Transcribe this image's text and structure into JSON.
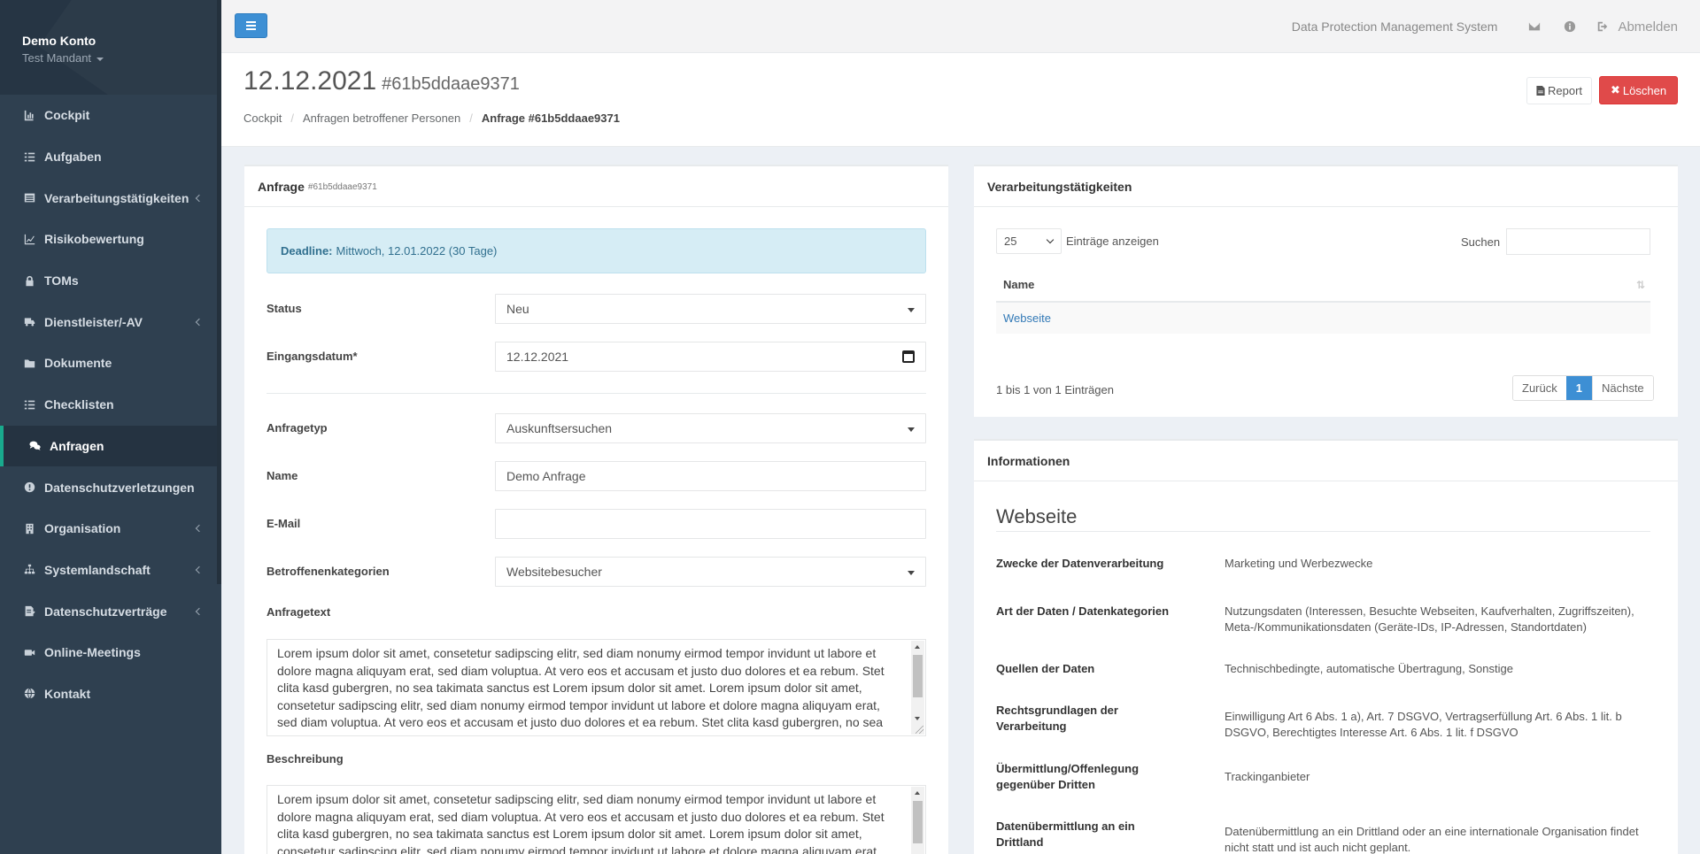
{
  "account": {
    "name": "Demo Konto",
    "tenant": "Test Mandant"
  },
  "nav": [
    {
      "label": "Cockpit",
      "icon": "chart-icon",
      "has_sub": false,
      "active": false
    },
    {
      "label": "Aufgaben",
      "icon": "tasks-icon",
      "has_sub": false,
      "active": false
    },
    {
      "label": "Verarbeitungstätigkeiten",
      "icon": "list-alt-icon",
      "has_sub": true,
      "active": false
    },
    {
      "label": "Risikobewertung",
      "icon": "line-chart-icon",
      "has_sub": false,
      "active": false
    },
    {
      "label": "TOMs",
      "icon": "lock-icon",
      "has_sub": false,
      "active": false
    },
    {
      "label": "Dienstleister/-AV",
      "icon": "truck-icon",
      "has_sub": true,
      "active": false
    },
    {
      "label": "Dokumente",
      "icon": "folder-icon",
      "has_sub": false,
      "active": false
    },
    {
      "label": "Checklisten",
      "icon": "checklist-icon",
      "has_sub": false,
      "active": false
    },
    {
      "label": "Anfragen",
      "icon": "comments-icon",
      "has_sub": false,
      "active": true
    },
    {
      "label": "Datenschutzverletzungen",
      "icon": "alert-circle-icon",
      "has_sub": false,
      "active": false
    },
    {
      "label": "Organisation",
      "icon": "building-icon",
      "has_sub": true,
      "active": false
    },
    {
      "label": "Systemlandschaft",
      "icon": "sitemap-icon",
      "has_sub": true,
      "active": false
    },
    {
      "label": "Datenschutzverträge",
      "icon": "contract-icon",
      "has_sub": true,
      "active": false
    },
    {
      "label": "Online-Meetings",
      "icon": "video-icon",
      "has_sub": false,
      "active": false
    },
    {
      "label": "Kontakt",
      "icon": "globe-icon",
      "has_sub": false,
      "active": false
    }
  ],
  "topbar": {
    "system_name": "Data Protection Management System",
    "logout_label": "Abmelden"
  },
  "heading": {
    "title": "12.12.2021",
    "id": "#61b5ddaae9371",
    "breadcrumb": [
      "Cockpit",
      "Anfragen betroffener Personen",
      "Anfrage #61b5ddaae9371"
    ],
    "report_label": "Report",
    "delete_label": "Löschen"
  },
  "request": {
    "panel_title": "Anfrage",
    "panel_id": "#61b5ddaae9371",
    "deadline_label": "Deadline:",
    "deadline_value": "Mittwoch, 12.01.2022 (30 Tage)",
    "fields": {
      "status": {
        "label": "Status",
        "value": "Neu"
      },
      "date": {
        "label": "Eingangsdatum*",
        "value": "12.12.2021"
      },
      "type": {
        "label": "Anfragetyp",
        "value": "Auskunftsersuchen"
      },
      "name": {
        "label": "Name",
        "value": "Demo Anfrage"
      },
      "email": {
        "label": "E-Mail",
        "value": ""
      },
      "categories": {
        "label": "Betroffenenkategorien",
        "value": "Websitebesucher"
      },
      "text": {
        "label": "Anfragetext",
        "value": "Lorem ipsum dolor sit amet, consetetur sadipscing elitr, sed diam nonumy eirmod tempor invidunt ut labore et dolore magna aliquyam erat, sed diam voluptua. At vero eos et accusam et justo duo dolores et ea rebum. Stet clita kasd gubergren, no sea takimata sanctus est Lorem ipsum dolor sit amet. Lorem ipsum dolor sit amet, consetetur sadipscing elitr, sed diam nonumy eirmod tempor invidunt ut labore et dolore magna aliquyam erat, sed diam voluptua. At vero eos et accusam et justo duo dolores et ea rebum. Stet clita kasd gubergren, no sea takimata sanctus est Lorem ipsum dolor sit amet."
      },
      "description": {
        "label": "Beschreibung",
        "value": "Lorem ipsum dolor sit amet, consetetur sadipscing elitr, sed diam nonumy eirmod tempor invidunt ut labore et dolore magna aliquyam erat, sed diam voluptua. At vero eos et accusam et justo duo dolores et ea rebum. Stet clita kasd gubergren, no sea takimata sanctus est Lorem ipsum dolor sit amet. Lorem ipsum dolor sit amet, consetetur sadipscing elitr, sed diam nonumy eirmod tempor invidunt ut labore et dolore magna aliquyam erat."
      }
    }
  },
  "activities": {
    "panel_title": "Verarbeitungstätigkeiten",
    "length_value": "25",
    "length_label": "Einträge anzeigen",
    "search_label": "Suchen",
    "column_name": "Name",
    "rows": [
      "Webseite"
    ],
    "info": "1 bis 1 von 1 Einträgen",
    "prev_label": "Zurück",
    "page": "1",
    "next_label": "Nächste"
  },
  "info": {
    "panel_title": "Informationen",
    "title": "Webseite",
    "rows": [
      {
        "key": "Zwecke der Datenverarbeitung",
        "value": "Marketing und Werbezwecke"
      },
      {
        "key": "Art der Daten / Datenkategorien",
        "value": "Nutzungsdaten (Interessen, Besuchte Webseiten, Kaufverhalten, Zugriffszeiten), Meta-/Kommunikationsdaten (Geräte-IDs, IP-Adressen, Standortdaten)"
      },
      {
        "key": "Quellen der Daten",
        "value": "Technischbedingte, automatische Übertragung, Sonstige"
      },
      {
        "key": "Rechtsgrundlagen der Verarbeitung",
        "value": "Einwilligung Art 6 Abs. 1 a), Art. 7 DSGVO, Vertragserfüllung Art. 6 Abs. 1 lit. b DSGVO, Berechtigtes Interesse Art. 6 Abs. 1 lit. f DSGVO"
      },
      {
        "key": "Übermittlung/Offenlegung gegenüber Dritten",
        "value": "Trackinganbieter"
      },
      {
        "key": "Datenübermittlung an ein Drittland",
        "value": "Datenübermittlung an ein Drittland oder an eine internationale Organisation findet nicht statt und ist auch nicht geplant."
      }
    ]
  }
}
